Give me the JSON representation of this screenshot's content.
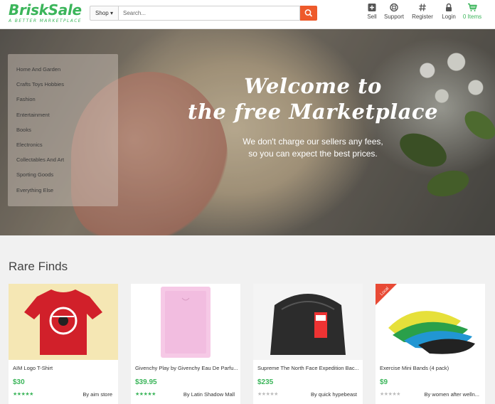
{
  "header": {
    "logo_main": "BriskSale",
    "logo_tagline": "A BETTER MARKETPLACE",
    "shop_label": "Shop ▾",
    "search_placeholder": "Search...",
    "nav": [
      {
        "label": "Sell",
        "icon": "plus-square-icon"
      },
      {
        "label": "Support",
        "icon": "lifebuoy-icon"
      },
      {
        "label": "Register",
        "icon": "hash-icon"
      },
      {
        "label": "Login",
        "icon": "lock-icon"
      },
      {
        "label": "0 Items",
        "icon": "cart-icon"
      }
    ],
    "accent": "#3bb55a",
    "search_button_color": "#ee5a2b"
  },
  "categories": [
    "Home And Garden",
    "Crafts Toys Hobbies",
    "Fashion",
    "Entertainment",
    "Books",
    "Electronics",
    "Collectables And Art",
    "Sporting Goods",
    "Everything Else"
  ],
  "hero": {
    "title_line1": "Welcome to",
    "title_line2": "the free Marketplace",
    "subtitle_line1": "We don't charge our sellers any fees,",
    "subtitle_line2": "so you can expect the best prices."
  },
  "rare_finds": {
    "title": "Rare Finds",
    "items": [
      {
        "name": "AIM Logo T-Shirt",
        "price": "$30",
        "rating": 5,
        "seller": "By aim store"
      },
      {
        "name": "Givenchy Play by Givenchy Eau De Parfu...",
        "price": "$39.95",
        "rating": 5,
        "seller": "By Latin Shadow Mall"
      },
      {
        "name": "Supreme The North Face Expedition Bac...",
        "price": "$235",
        "rating": 0,
        "seller": "By quick hypebeast"
      },
      {
        "name": "Exercise Mini Bands (4 pack)",
        "price": "$9",
        "rating": 0,
        "seller": "By women after welln..."
      }
    ],
    "badge": "Local"
  }
}
